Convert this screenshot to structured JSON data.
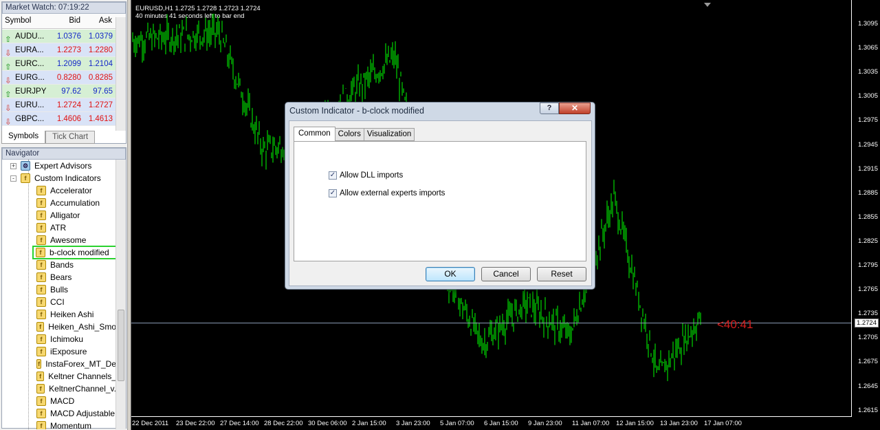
{
  "market_watch": {
    "title": "Market Watch: 07:19:22",
    "headers": {
      "symbol": "Symbol",
      "bid": "Bid",
      "ask": "Ask"
    },
    "rows": [
      {
        "symbol": "AUDU...",
        "bid": "1.0376",
        "ask": "1.0379",
        "dir": "up"
      },
      {
        "symbol": "EURA...",
        "bid": "1.2273",
        "ask": "1.2280",
        "dir": "down"
      },
      {
        "symbol": "EURC...",
        "bid": "1.2099",
        "ask": "1.2104",
        "dir": "up"
      },
      {
        "symbol": "EURG...",
        "bid": "0.8280",
        "ask": "0.8285",
        "dir": "down"
      },
      {
        "symbol": "EURJPY",
        "bid": "97.62",
        "ask": "97.65",
        "dir": "up"
      },
      {
        "symbol": "EURU...",
        "bid": "1.2724",
        "ask": "1.2727",
        "dir": "down"
      },
      {
        "symbol": "GBPC...",
        "bid": "1.4606",
        "ask": "1.4613",
        "dir": "down"
      }
    ],
    "tabs": [
      "Symbols",
      "Tick Chart"
    ]
  },
  "navigator": {
    "title": "Navigator",
    "groups": [
      {
        "label": "Expert Advisors",
        "expander": "+"
      },
      {
        "label": "Custom Indicators",
        "expander": "-"
      }
    ],
    "indicators": [
      "Accelerator",
      "Accumulation",
      "Alligator",
      "ATR",
      "Awesome",
      "b-clock modified",
      "Bands",
      "Bears",
      "Bulls",
      "CCI",
      "Heiken Ashi",
      "Heiken_Ashi_Smo",
      "Ichimoku",
      "iExposure",
      "InstaForex_MT_De",
      "Keltner Channels_",
      "KeltnerChannel_v.",
      "MACD",
      "MACD Adjustable",
      "Momentum"
    ],
    "selected_index": 5
  },
  "chart": {
    "info_line1": "EURUSD,H1  1.2725 1.2728 1.2723 1.2724",
    "info_line2": "40 minutes 41 seconds left to bar end",
    "price_ticks": [
      "1.3095",
      "1.3065",
      "1.3035",
      "1.3005",
      "1.2975",
      "1.2945",
      "1.2915",
      "1.2885",
      "1.2855",
      "1.2825",
      "1.2795",
      "1.2765",
      "1.2735",
      "1.2705",
      "1.2675",
      "1.2645",
      "1.2615"
    ],
    "bid_label": "1.2724",
    "time_ticks": [
      "22 Dec 2011",
      "23 Dec 22:00",
      "27 Dec 14:00",
      "28 Dec 22:00",
      "30 Dec 06:00",
      "2 Jan 15:00",
      "3 Jan 23:00",
      "5 Jan 07:00",
      "6 Jan 15:00",
      "9 Jan 23:00",
      "11 Jan 07:00",
      "12 Jan 15:00",
      "13 Jan 23:00",
      "17 Jan 07:00"
    ],
    "clock_text": "<40:41",
    "bar_color": "#00ff00",
    "chart_data": {
      "type": "line",
      "x": [
        "22 Dec 2011",
        "23 Dec 22:00",
        "27 Dec 14:00",
        "28 Dec 22:00",
        "30 Dec 06:00",
        "2 Jan 15:00",
        "3 Jan 23:00",
        "5 Jan 07:00",
        "6 Jan 15:00",
        "9 Jan 23:00",
        "11 Jan 07:00",
        "12 Jan 15:00",
        "13 Jan 23:00",
        "17 Jan 07:00"
      ],
      "series": [
        {
          "values": [
            1.3065,
            1.307,
            1.3075,
            1.293,
            1.294,
            1.3,
            1.3045,
            1.279,
            1.269,
            1.274,
            1.27,
            1.287,
            1.265,
            1.2724
          ]
        }
      ],
      "ylim": [
        1.26,
        1.3115
      ]
    }
  },
  "dialog": {
    "title": "Custom Indicator - b-clock modified",
    "help": "?",
    "close": "✕",
    "tabs": [
      "Common",
      "Colors",
      "Visualization"
    ],
    "checkboxes": [
      {
        "label": "Allow DLL imports",
        "checked": "✓"
      },
      {
        "label": "Allow external experts imports",
        "checked": "✓"
      }
    ],
    "buttons": {
      "ok": "OK",
      "cancel": "Cancel",
      "reset": "Reset"
    }
  }
}
